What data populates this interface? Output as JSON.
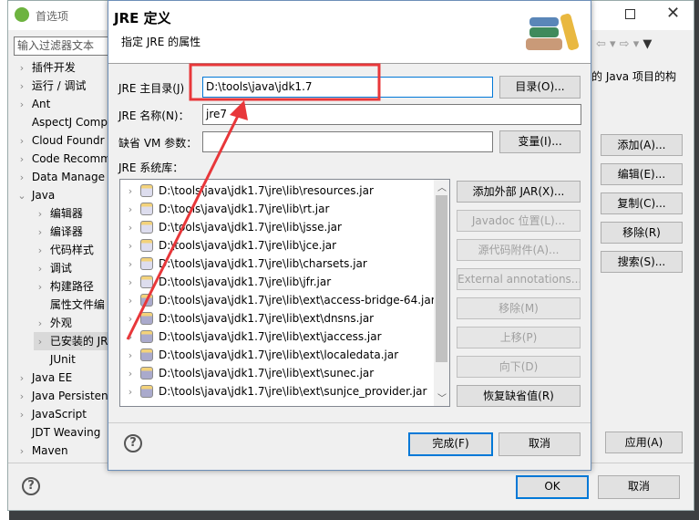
{
  "prefs": {
    "title": "首选项",
    "filter_placeholder": "输入过滤器文本",
    "tree": [
      {
        "label": "插件开发",
        "chevron": true,
        "indent": 0
      },
      {
        "label": "运行 / 调试",
        "chevron": true,
        "indent": 0
      },
      {
        "label": "Ant",
        "chevron": true,
        "indent": 0
      },
      {
        "label": "AspectJ Comp",
        "chevron": false,
        "indent": 0
      },
      {
        "label": "Cloud Foundr",
        "chevron": true,
        "indent": 0
      },
      {
        "label": "Code Recomm",
        "chevron": true,
        "indent": 0
      },
      {
        "label": "Data Manage",
        "chevron": true,
        "indent": 0
      },
      {
        "label": "Java",
        "chevron": true,
        "expanded": true,
        "indent": 0
      },
      {
        "label": "编辑器",
        "chevron": true,
        "indent": 1
      },
      {
        "label": "编译器",
        "chevron": true,
        "indent": 1
      },
      {
        "label": "代码样式",
        "chevron": true,
        "indent": 1
      },
      {
        "label": "调试",
        "chevron": true,
        "indent": 1
      },
      {
        "label": "构建路径",
        "chevron": true,
        "indent": 1
      },
      {
        "label": "属性文件编",
        "chevron": false,
        "indent": 1
      },
      {
        "label": "外观",
        "chevron": true,
        "indent": 1
      },
      {
        "label": "已安装的 JR",
        "chevron": true,
        "indent": 1,
        "selected": true
      },
      {
        "label": "JUnit",
        "chevron": false,
        "indent": 1
      },
      {
        "label": "Java EE",
        "chevron": true,
        "indent": 0
      },
      {
        "label": "Java Persisten",
        "chevron": true,
        "indent": 0
      },
      {
        "label": "JavaScript",
        "chevron": true,
        "indent": 0
      },
      {
        "label": "JDT Weaving",
        "chevron": false,
        "indent": 0
      },
      {
        "label": "Maven",
        "chevron": true,
        "indent": 0
      }
    ],
    "description": "的 Java 项目的构",
    "side_buttons": [
      "添加(A)...",
      "编辑(E)...",
      "复制(C)...",
      "移除(R)",
      "搜索(S)..."
    ],
    "apply": "应用(A)",
    "ok": "OK",
    "cancel": "取消"
  },
  "dialog": {
    "title": "JRE 定义",
    "subtitle": "指定 JRE 的属性",
    "home_label": "JRE 主目录(J)",
    "home_value": "D:\\tools\\java\\jdk1.7",
    "dir_button": "目录(O)...",
    "name_label": "JRE 名称(N)：",
    "name_value": "jre7",
    "vm_label": "缺省 VM 参数：",
    "vm_value": "",
    "var_button": "变量(I)...",
    "libs_label": "JRE 系统库：",
    "libs": [
      {
        "path": "D:\\tools\\java\\jdk1.7\\jre\\lib\\resources.jar",
        "ext": false
      },
      {
        "path": "D:\\tools\\java\\jdk1.7\\jre\\lib\\rt.jar",
        "ext": false
      },
      {
        "path": "D:\\tools\\java\\jdk1.7\\jre\\lib\\jsse.jar",
        "ext": false
      },
      {
        "path": "D:\\tools\\java\\jdk1.7\\jre\\lib\\jce.jar",
        "ext": false
      },
      {
        "path": "D:\\tools\\java\\jdk1.7\\jre\\lib\\charsets.jar",
        "ext": false
      },
      {
        "path": "D:\\tools\\java\\jdk1.7\\jre\\lib\\jfr.jar",
        "ext": false
      },
      {
        "path": "D:\\tools\\java\\jdk1.7\\jre\\lib\\ext\\access-bridge-64.jar",
        "ext": true
      },
      {
        "path": "D:\\tools\\java\\jdk1.7\\jre\\lib\\ext\\dnsns.jar",
        "ext": true
      },
      {
        "path": "D:\\tools\\java\\jdk1.7\\jre\\lib\\ext\\jaccess.jar",
        "ext": true
      },
      {
        "path": "D:\\tools\\java\\jdk1.7\\jre\\lib\\ext\\localedata.jar",
        "ext": true
      },
      {
        "path": "D:\\tools\\java\\jdk1.7\\jre\\lib\\ext\\sunec.jar",
        "ext": true
      },
      {
        "path": "D:\\tools\\java\\jdk1.7\\jre\\lib\\ext\\sunjce_provider.jar",
        "ext": true
      }
    ],
    "lib_buttons": [
      {
        "label": "添加外部 JAR(X)...",
        "enabled": true
      },
      {
        "label": "Javadoc 位置(L)...",
        "enabled": false
      },
      {
        "label": "源代码附件(A)...",
        "enabled": false
      },
      {
        "label": "External annotations...",
        "enabled": false
      },
      {
        "label": "移除(M)",
        "enabled": false
      },
      {
        "label": "上移(P)",
        "enabled": false
      },
      {
        "label": "向下(D)",
        "enabled": false
      },
      {
        "label": "恢复缺省值(R)",
        "enabled": true
      }
    ],
    "finish": "完成(F)",
    "cancel": "取消"
  },
  "colors": {
    "annotation": "#e8373a",
    "focus": "#0078d7"
  }
}
